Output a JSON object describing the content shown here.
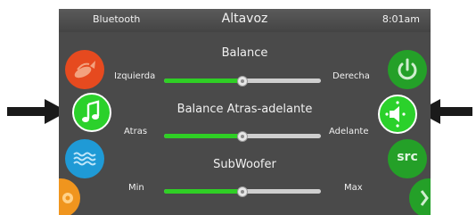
{
  "status": {
    "left": "Bluetooth",
    "title": "Altavoz",
    "time": "8:01am"
  },
  "sections": [
    {
      "title": "Balance",
      "min_label": "Izquierda",
      "max_label": "Derecha",
      "value": 0.5
    },
    {
      "title": "Balance Atras-adelante",
      "min_label": "Atras",
      "max_label": "Adelante",
      "value": 0.5
    },
    {
      "title": "SubWoofer",
      "min_label": "Min",
      "max_label": "Max",
      "value": 0.5
    }
  ],
  "right_buttons": {
    "src_label": "src"
  },
  "icons": {
    "left": [
      "fish-icon",
      "music-note-icon",
      "water-waves-icon",
      "gear-icon"
    ],
    "right": [
      "power-icon",
      "speaker-icon",
      "src-button",
      "chevron-right-icon"
    ]
  },
  "colors": {
    "accent_green": "#2fcf25",
    "music_green": "#2bd12b",
    "orange_red": "#e64a1f",
    "blue": "#1f9ad6",
    "orange": "#f0951e",
    "dark_green": "#24a028"
  }
}
